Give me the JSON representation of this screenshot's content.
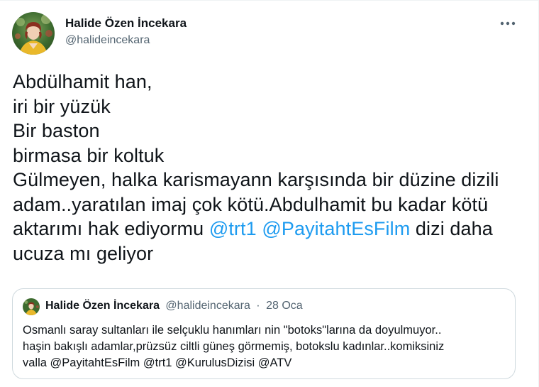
{
  "tweet": {
    "author": {
      "name": "Halide Özen İncekara",
      "handle": "@halideincekara",
      "avatar": "avatar-photo"
    },
    "more_icon": "more-horizontal-icon",
    "text_lines": [
      [
        {
          "t": "Abdülhamit han,"
        }
      ],
      [
        {
          "t": "iri bir yüzük"
        }
      ],
      [
        {
          "t": "Bir baston"
        }
      ],
      [
        {
          "t": "birmasa bir koltuk"
        }
      ],
      [
        {
          "t": "Gülmeyen, halka karismayann karşısında bir düzine dizili"
        }
      ],
      [
        {
          "t": "adam..yaratılan imaj çok kötü.Abdulhamit bu kadar kötü"
        }
      ],
      [
        {
          "t": "aktarımı hak ediyormu "
        },
        {
          "t": "@trt1",
          "mention": true
        },
        {
          "t": " "
        },
        {
          "t": "@PayitahtEsFilm",
          "mention": true
        },
        {
          "t": " dizi daha"
        }
      ],
      [
        {
          "t": "ucuza mı geliyor"
        }
      ]
    ],
    "quote": {
      "name": "Halide Özen İncekara",
      "handle": "@halideincekara",
      "separator": "·",
      "date": "28 Oca",
      "text_lines": [
        "Osmanlı saray sultanları ile selçuklu hanımları nin \"botoks\"larına da doyulmuyor..",
        "haşin bakışlı adamlar,prüzsüz ciltli güneş görmemiş, botokslu kadınlar..komiksiniz",
        "valla @PayitahtEsFilm @trt1 @KurulusDizisi @ATV"
      ]
    }
  },
  "colors": {
    "text": "#0f1419",
    "secondary": "#536471",
    "link": "#1d9bf0",
    "border": "#cfd9de",
    "avatar_bg": "#3d6b2f",
    "avatar_shirt": "#e9b82a"
  }
}
